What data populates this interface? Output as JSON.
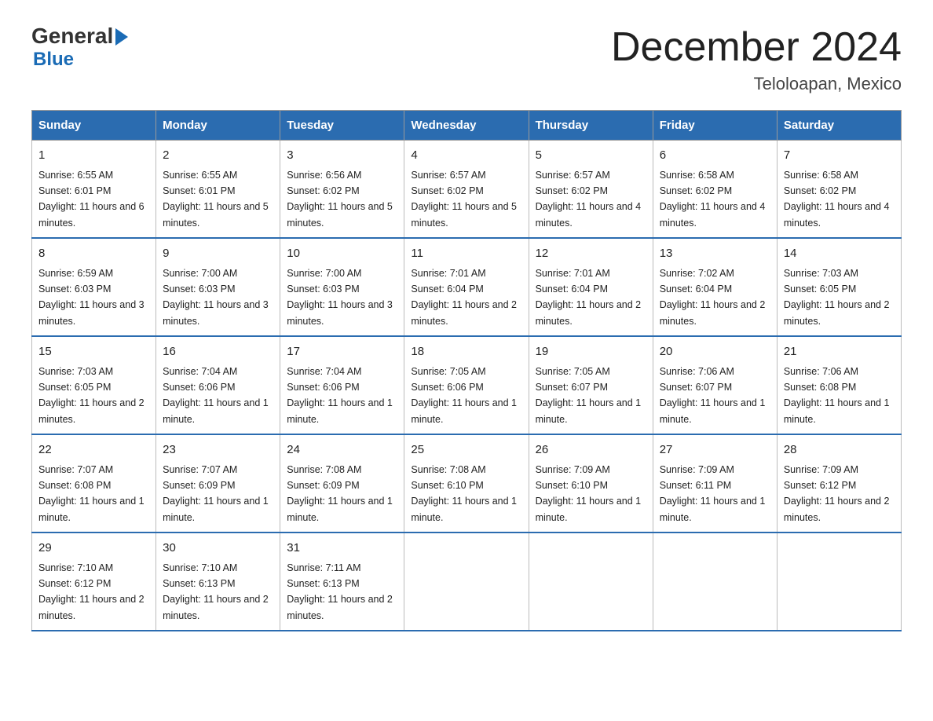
{
  "logo": {
    "general": "General",
    "blue": "Blue"
  },
  "header": {
    "title": "December 2024",
    "subtitle": "Teloloapan, Mexico"
  },
  "days_of_week": [
    "Sunday",
    "Monday",
    "Tuesday",
    "Wednesday",
    "Thursday",
    "Friday",
    "Saturday"
  ],
  "weeks": [
    [
      {
        "day": "1",
        "sunrise": "6:55 AM",
        "sunset": "6:01 PM",
        "daylight": "11 hours and 6 minutes."
      },
      {
        "day": "2",
        "sunrise": "6:55 AM",
        "sunset": "6:01 PM",
        "daylight": "11 hours and 5 minutes."
      },
      {
        "day": "3",
        "sunrise": "6:56 AM",
        "sunset": "6:02 PM",
        "daylight": "11 hours and 5 minutes."
      },
      {
        "day": "4",
        "sunrise": "6:57 AM",
        "sunset": "6:02 PM",
        "daylight": "11 hours and 5 minutes."
      },
      {
        "day": "5",
        "sunrise": "6:57 AM",
        "sunset": "6:02 PM",
        "daylight": "11 hours and 4 minutes."
      },
      {
        "day": "6",
        "sunrise": "6:58 AM",
        "sunset": "6:02 PM",
        "daylight": "11 hours and 4 minutes."
      },
      {
        "day": "7",
        "sunrise": "6:58 AM",
        "sunset": "6:02 PM",
        "daylight": "11 hours and 4 minutes."
      }
    ],
    [
      {
        "day": "8",
        "sunrise": "6:59 AM",
        "sunset": "6:03 PM",
        "daylight": "11 hours and 3 minutes."
      },
      {
        "day": "9",
        "sunrise": "7:00 AM",
        "sunset": "6:03 PM",
        "daylight": "11 hours and 3 minutes."
      },
      {
        "day": "10",
        "sunrise": "7:00 AM",
        "sunset": "6:03 PM",
        "daylight": "11 hours and 3 minutes."
      },
      {
        "day": "11",
        "sunrise": "7:01 AM",
        "sunset": "6:04 PM",
        "daylight": "11 hours and 2 minutes."
      },
      {
        "day": "12",
        "sunrise": "7:01 AM",
        "sunset": "6:04 PM",
        "daylight": "11 hours and 2 minutes."
      },
      {
        "day": "13",
        "sunrise": "7:02 AM",
        "sunset": "6:04 PM",
        "daylight": "11 hours and 2 minutes."
      },
      {
        "day": "14",
        "sunrise": "7:03 AM",
        "sunset": "6:05 PM",
        "daylight": "11 hours and 2 minutes."
      }
    ],
    [
      {
        "day": "15",
        "sunrise": "7:03 AM",
        "sunset": "6:05 PM",
        "daylight": "11 hours and 2 minutes."
      },
      {
        "day": "16",
        "sunrise": "7:04 AM",
        "sunset": "6:06 PM",
        "daylight": "11 hours and 1 minute."
      },
      {
        "day": "17",
        "sunrise": "7:04 AM",
        "sunset": "6:06 PM",
        "daylight": "11 hours and 1 minute."
      },
      {
        "day": "18",
        "sunrise": "7:05 AM",
        "sunset": "6:06 PM",
        "daylight": "11 hours and 1 minute."
      },
      {
        "day": "19",
        "sunrise": "7:05 AM",
        "sunset": "6:07 PM",
        "daylight": "11 hours and 1 minute."
      },
      {
        "day": "20",
        "sunrise": "7:06 AM",
        "sunset": "6:07 PM",
        "daylight": "11 hours and 1 minute."
      },
      {
        "day": "21",
        "sunrise": "7:06 AM",
        "sunset": "6:08 PM",
        "daylight": "11 hours and 1 minute."
      }
    ],
    [
      {
        "day": "22",
        "sunrise": "7:07 AM",
        "sunset": "6:08 PM",
        "daylight": "11 hours and 1 minute."
      },
      {
        "day": "23",
        "sunrise": "7:07 AM",
        "sunset": "6:09 PM",
        "daylight": "11 hours and 1 minute."
      },
      {
        "day": "24",
        "sunrise": "7:08 AM",
        "sunset": "6:09 PM",
        "daylight": "11 hours and 1 minute."
      },
      {
        "day": "25",
        "sunrise": "7:08 AM",
        "sunset": "6:10 PM",
        "daylight": "11 hours and 1 minute."
      },
      {
        "day": "26",
        "sunrise": "7:09 AM",
        "sunset": "6:10 PM",
        "daylight": "11 hours and 1 minute."
      },
      {
        "day": "27",
        "sunrise": "7:09 AM",
        "sunset": "6:11 PM",
        "daylight": "11 hours and 1 minute."
      },
      {
        "day": "28",
        "sunrise": "7:09 AM",
        "sunset": "6:12 PM",
        "daylight": "11 hours and 2 minutes."
      }
    ],
    [
      {
        "day": "29",
        "sunrise": "7:10 AM",
        "sunset": "6:12 PM",
        "daylight": "11 hours and 2 minutes."
      },
      {
        "day": "30",
        "sunrise": "7:10 AM",
        "sunset": "6:13 PM",
        "daylight": "11 hours and 2 minutes."
      },
      {
        "day": "31",
        "sunrise": "7:11 AM",
        "sunset": "6:13 PM",
        "daylight": "11 hours and 2 minutes."
      },
      null,
      null,
      null,
      null
    ]
  ]
}
